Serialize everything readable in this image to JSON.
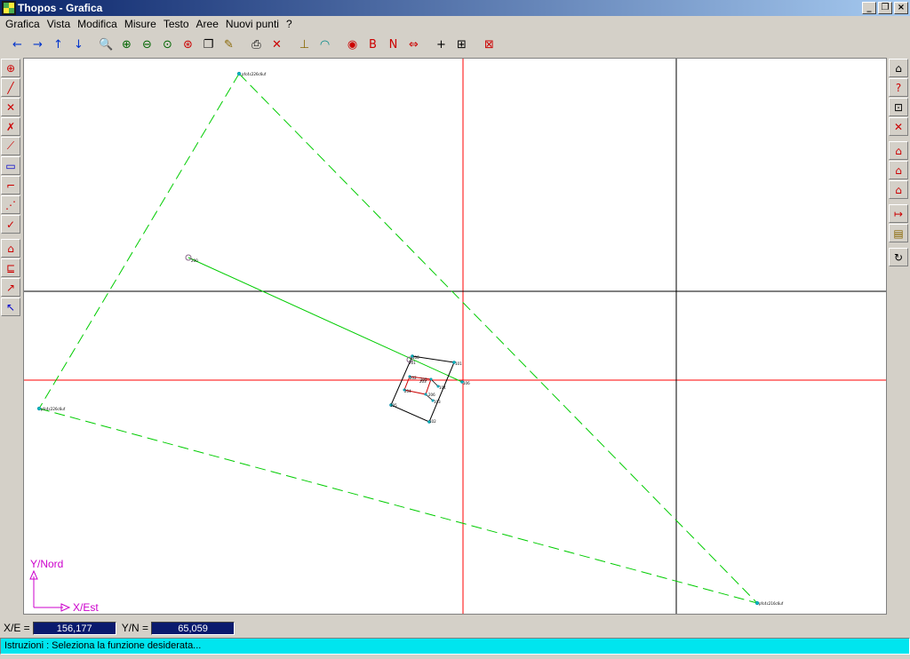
{
  "window": {
    "title": "Thopos - Grafica"
  },
  "menu": [
    "Grafica",
    "Vista",
    "Modifica",
    "Misure",
    "Testo",
    "Aree",
    "Nuovi punti",
    "?"
  ],
  "toolbar": [
    {
      "name": "pan-left-icon",
      "glyph": "←",
      "color": "#0033cc"
    },
    {
      "name": "pan-right-icon",
      "glyph": "→",
      "color": "#0033cc"
    },
    {
      "name": "pan-up-icon",
      "glyph": "↑",
      "color": "#0033cc"
    },
    {
      "name": "pan-down-icon",
      "glyph": "↓",
      "color": "#0033cc"
    },
    {
      "sep": true
    },
    {
      "name": "zoom-icon",
      "glyph": "🔍",
      "color": "#006600"
    },
    {
      "name": "zoom-in-icon",
      "glyph": "⊕",
      "color": "#006600"
    },
    {
      "name": "zoom-out-icon",
      "glyph": "⊖",
      "color": "#006600"
    },
    {
      "name": "zoom-window-icon",
      "glyph": "⊙",
      "color": "#006600"
    },
    {
      "name": "zoom-extents-icon",
      "glyph": "⊛",
      "color": "#cc0000"
    },
    {
      "name": "copy-icon",
      "glyph": "❐",
      "color": "#000000"
    },
    {
      "name": "edit-icon",
      "glyph": "✎",
      "color": "#886600"
    },
    {
      "sep": true
    },
    {
      "name": "print-icon",
      "glyph": "⎙",
      "color": "#000000"
    },
    {
      "name": "export-dxf-icon",
      "glyph": "✕",
      "color": "#cc0000"
    },
    {
      "sep": true
    },
    {
      "name": "measure-icon",
      "glyph": "⊥",
      "color": "#886600"
    },
    {
      "name": "angle-icon",
      "glyph": "◠",
      "color": "#008888"
    },
    {
      "sep": true
    },
    {
      "name": "layer-icon",
      "glyph": "◉",
      "color": "#cc0000"
    },
    {
      "name": "point-b-icon",
      "glyph": "B",
      "color": "#cc0000"
    },
    {
      "name": "north-icon",
      "glyph": "N",
      "color": "#cc0000"
    },
    {
      "name": "north-arrows-icon",
      "glyph": "⇔",
      "color": "#cc0000"
    },
    {
      "sep": true
    },
    {
      "name": "crosshair-icon",
      "glyph": "+",
      "color": "#000000"
    },
    {
      "name": "grid-icon",
      "glyph": "⊞",
      "color": "#000000"
    },
    {
      "sep": true
    },
    {
      "name": "delete-icon",
      "glyph": "⊠",
      "color": "#cc0000"
    }
  ],
  "left_tools": [
    {
      "name": "add-point-icon",
      "glyph": "⊕",
      "color": "#cc0000"
    },
    {
      "name": "line-icon",
      "glyph": "╱",
      "color": "#cc0000"
    },
    {
      "name": "intersect-icon",
      "glyph": "✕",
      "color": "#cc0000"
    },
    {
      "name": "perpendicular-icon",
      "glyph": "✗",
      "color": "#cc0000"
    },
    {
      "name": "segment-icon",
      "glyph": "⟋",
      "color": "#cc0000"
    },
    {
      "name": "rect-icon",
      "glyph": "▭",
      "color": "#0000cc"
    },
    {
      "name": "polyline-icon",
      "glyph": "⌐",
      "color": "#cc0000"
    },
    {
      "name": "dashed-line-icon",
      "glyph": "⋰",
      "color": "#cc0000"
    },
    {
      "name": "check-line-icon",
      "glyph": "✓",
      "color": "#cc0000"
    },
    {
      "gap": true
    },
    {
      "name": "house-icon",
      "glyph": "⌂",
      "color": "#cc0000"
    },
    {
      "name": "offset-icon",
      "glyph": "⊑",
      "color": "#cc0000"
    },
    {
      "name": "offset-point-icon",
      "glyph": "↗",
      "color": "#cc0000"
    },
    {
      "name": "offset-back-icon",
      "glyph": "↖",
      "color": "#0000cc"
    }
  ],
  "right_tools": [
    {
      "name": "home-icon",
      "glyph": "⌂",
      "color": "#000000"
    },
    {
      "name": "query-icon",
      "glyph": "?",
      "color": "#cc0000"
    },
    {
      "name": "frame-icon",
      "glyph": "⊡",
      "color": "#000000"
    },
    {
      "name": "close-red-icon",
      "glyph": "✕",
      "color": "#cc0000"
    },
    {
      "gap": true
    },
    {
      "name": "area-icon",
      "glyph": "⌂",
      "color": "#cc0000"
    },
    {
      "name": "area-split-icon",
      "glyph": "⌂",
      "color": "#cc0000"
    },
    {
      "name": "area-check-icon",
      "glyph": "⌂",
      "color": "#cc0000"
    },
    {
      "gap": true
    },
    {
      "name": "transform-icon",
      "glyph": "↦",
      "color": "#cc0000"
    },
    {
      "name": "map-icon",
      "glyph": "▤",
      "color": "#886600"
    },
    {
      "gap": true
    },
    {
      "name": "rotate-icon",
      "glyph": "↻",
      "color": "#000000"
    }
  ],
  "axes": {
    "y_label": "Y/Nord",
    "x_label": "X/Est",
    "color": "#cc00cc"
  },
  "points": [
    {
      "id": "top-vertex",
      "label": "pfc4c226c6uf"
    },
    {
      "id": "left-vertex",
      "label": "pfc4c226c6uf"
    },
    {
      "id": "bottom-vertex",
      "label": "pfc4c216c6uf"
    },
    {
      "id": "p100",
      "label": "100"
    },
    {
      "id": "p101",
      "label": "101"
    },
    {
      "id": "p102",
      "label": "102"
    },
    {
      "id": "p103",
      "label": "103"
    },
    {
      "id": "p104",
      "label": "104"
    },
    {
      "id": "p105",
      "label": "105"
    },
    {
      "id": "p106",
      "label": "106"
    },
    {
      "id": "p200",
      "label": "200"
    },
    {
      "id": "p201",
      "label": "201"
    },
    {
      "id": "p202",
      "label": "202"
    },
    {
      "id": "p203",
      "label": "203"
    },
    {
      "id": "p204",
      "label": "204"
    },
    {
      "id": "p205",
      "label": "205"
    },
    {
      "id": "p206",
      "label": "206"
    }
  ],
  "coords": {
    "x_label": "X/E =",
    "x_value": "156,177",
    "y_label": "Y/N =",
    "y_value": "65,059"
  },
  "status": {
    "text": "Istruzioni :  Seleziona la funzione desiderata..."
  },
  "colors": {
    "grid_red": "#ff0000",
    "grid_black": "#000000",
    "survey_green": "#00cc00",
    "status_bg": "#00e5ef",
    "coord_bg": "#0a1a6e"
  }
}
